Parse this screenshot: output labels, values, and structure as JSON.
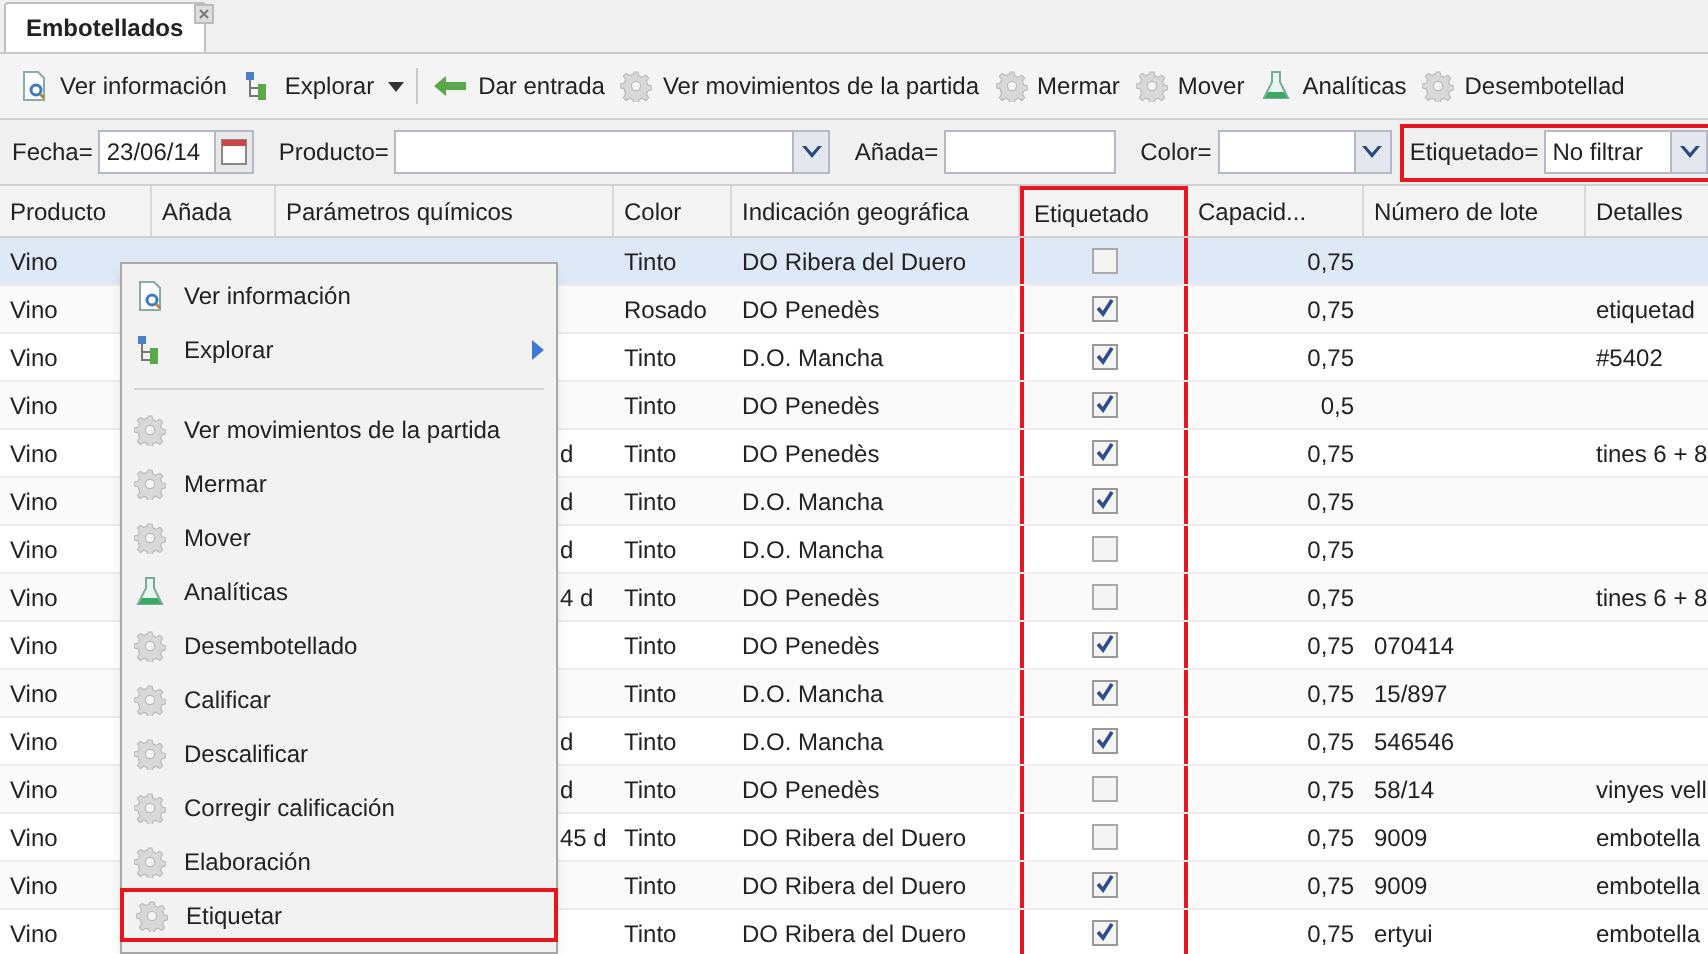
{
  "tabs": [
    {
      "label": "Embotellados",
      "selected": true
    }
  ],
  "toolbar": [
    {
      "kind": "page",
      "label": "Ver información"
    },
    {
      "kind": "tree",
      "label": "Explorar",
      "dropdown": true
    },
    {
      "kind": "arrow",
      "label": "Dar entrada"
    },
    {
      "kind": "gear",
      "label": "Ver movimientos de la partida"
    },
    {
      "kind": "gear",
      "label": "Mermar"
    },
    {
      "kind": "gear",
      "label": "Mover"
    },
    {
      "kind": "flask",
      "label": "Analíticas"
    },
    {
      "kind": "gear",
      "label": "Desembotellad"
    }
  ],
  "filters": [
    {
      "kind": "date",
      "label": "Fecha=",
      "value": "23/06/14"
    },
    {
      "kind": "combo",
      "label": "Producto="
    },
    {
      "kind": "text",
      "label": "Añada="
    },
    {
      "kind": "combo",
      "label": "Color="
    },
    {
      "kind": "combo",
      "label": "Etiquetado=",
      "value": "No filtrar",
      "highlighted": true
    }
  ],
  "table": {
    "columns": [
      {
        "label": "Producto",
        "highlighted": false
      },
      {
        "label": "Añada",
        "highlighted": false
      },
      {
        "label": "Parámetros químicos",
        "highlighted": false
      },
      {
        "label": "Color",
        "highlighted": false
      },
      {
        "label": "Indicación geográfica",
        "highlighted": false
      },
      {
        "label": "Etiquetado",
        "highlighted": true
      },
      {
        "label": "Capacid...",
        "highlighted": false
      },
      {
        "label": "Número de lote",
        "highlighted": false
      },
      {
        "label": "Detalles",
        "highlighted": false
      }
    ],
    "rows": [
      {
        "selected": true,
        "cells": [
          "Vino",
          "",
          "",
          "Tinto",
          "DO Ribera del Duero",
          "",
          "0,75",
          "",
          ""
        ],
        "labeled": false
      },
      {
        "selected": false,
        "cells": [
          "Vino",
          "",
          "",
          "Rosado",
          "DO Penedès",
          "",
          "0,75",
          "",
          "etiquetad"
        ],
        "labeled": true
      },
      {
        "selected": false,
        "cells": [
          "Vino",
          "",
          "",
          "Tinto",
          "D.O. Mancha",
          "",
          "0,75",
          "",
          "#5402"
        ],
        "labeled": true
      },
      {
        "selected": false,
        "cells": [
          "Vino",
          "",
          "",
          "Tinto",
          "DO Penedès",
          "",
          "0,5",
          "",
          ""
        ],
        "labeled": true
      },
      {
        "selected": false,
        "cells": [
          "Vino",
          "",
          "d",
          "Tinto",
          "DO Penedès",
          "",
          "0,75",
          "",
          "tines 6 + 8"
        ],
        "labeled": true
      },
      {
        "selected": false,
        "cells": [
          "Vino",
          "",
          "d",
          "Tinto",
          "D.O. Mancha",
          "",
          "0,75",
          "",
          ""
        ],
        "labeled": true
      },
      {
        "selected": false,
        "cells": [
          "Vino",
          "",
          "d",
          "Tinto",
          "D.O. Mancha",
          "",
          "0,75",
          "",
          ""
        ],
        "labeled": false
      },
      {
        "selected": false,
        "cells": [
          "Vino",
          "",
          "4 d",
          "Tinto",
          "DO Penedès",
          "",
          "0,75",
          "",
          "tines 6 + 8"
        ],
        "labeled": false
      },
      {
        "selected": false,
        "cells": [
          "Vino",
          "",
          "",
          "Tinto",
          "DO Penedès",
          "",
          "0,75",
          "070414",
          ""
        ],
        "labeled": true
      },
      {
        "selected": false,
        "cells": [
          "Vino",
          "",
          "",
          "Tinto",
          "D.O. Mancha",
          "",
          "0,75",
          "15/897",
          ""
        ],
        "labeled": true
      },
      {
        "selected": false,
        "cells": [
          "Vino",
          "",
          "d",
          "Tinto",
          "D.O. Mancha",
          "",
          "0,75",
          "546546",
          ""
        ],
        "labeled": true
      },
      {
        "selected": false,
        "cells": [
          "Vino",
          "",
          "d",
          "Tinto",
          "DO Penedès",
          "",
          "0,75",
          "58/14",
          "vinyes vell"
        ],
        "labeled": false
      },
      {
        "selected": false,
        "cells": [
          "Vino",
          "",
          "45 d",
          "Tinto",
          "DO Ribera del Duero",
          "",
          "0,75",
          "9009",
          "embotella"
        ],
        "labeled": false
      },
      {
        "selected": false,
        "cells": [
          "Vino",
          "",
          "",
          "Tinto",
          "DO Ribera del Duero",
          "",
          "0,75",
          "9009",
          "embotella"
        ],
        "labeled": true
      },
      {
        "selected": false,
        "cells": [
          "Vino",
          "",
          "",
          "Tinto",
          "DO Ribera del Duero",
          "",
          "0,75",
          "ertyui",
          "embotella"
        ],
        "labeled": true
      }
    ]
  },
  "context_menu": [
    {
      "kind": "page",
      "label": "Ver información",
      "selected": false
    },
    {
      "kind": "tree",
      "label": "Explorar",
      "submenu": true,
      "selected": false
    },
    {
      "kind": "separator"
    },
    {
      "kind": "gear",
      "label": "Ver movimientos de la partida",
      "selected": false
    },
    {
      "kind": "gear",
      "label": "Mermar",
      "selected": false
    },
    {
      "kind": "gear",
      "label": "Mover",
      "selected": false
    },
    {
      "kind": "flask",
      "label": "Analíticas",
      "selected": false
    },
    {
      "kind": "gear",
      "label": "Desembotellado",
      "selected": false
    },
    {
      "kind": "gear",
      "label": "Calificar",
      "selected": false
    },
    {
      "kind": "gear",
      "label": "Descalificar",
      "selected": false
    },
    {
      "kind": "gear",
      "label": "Corregir calificación",
      "selected": false
    },
    {
      "kind": "gear",
      "label": "Elaboración",
      "selected": false
    },
    {
      "kind": "gear",
      "label": "Etiquetar",
      "selected": true
    }
  ]
}
